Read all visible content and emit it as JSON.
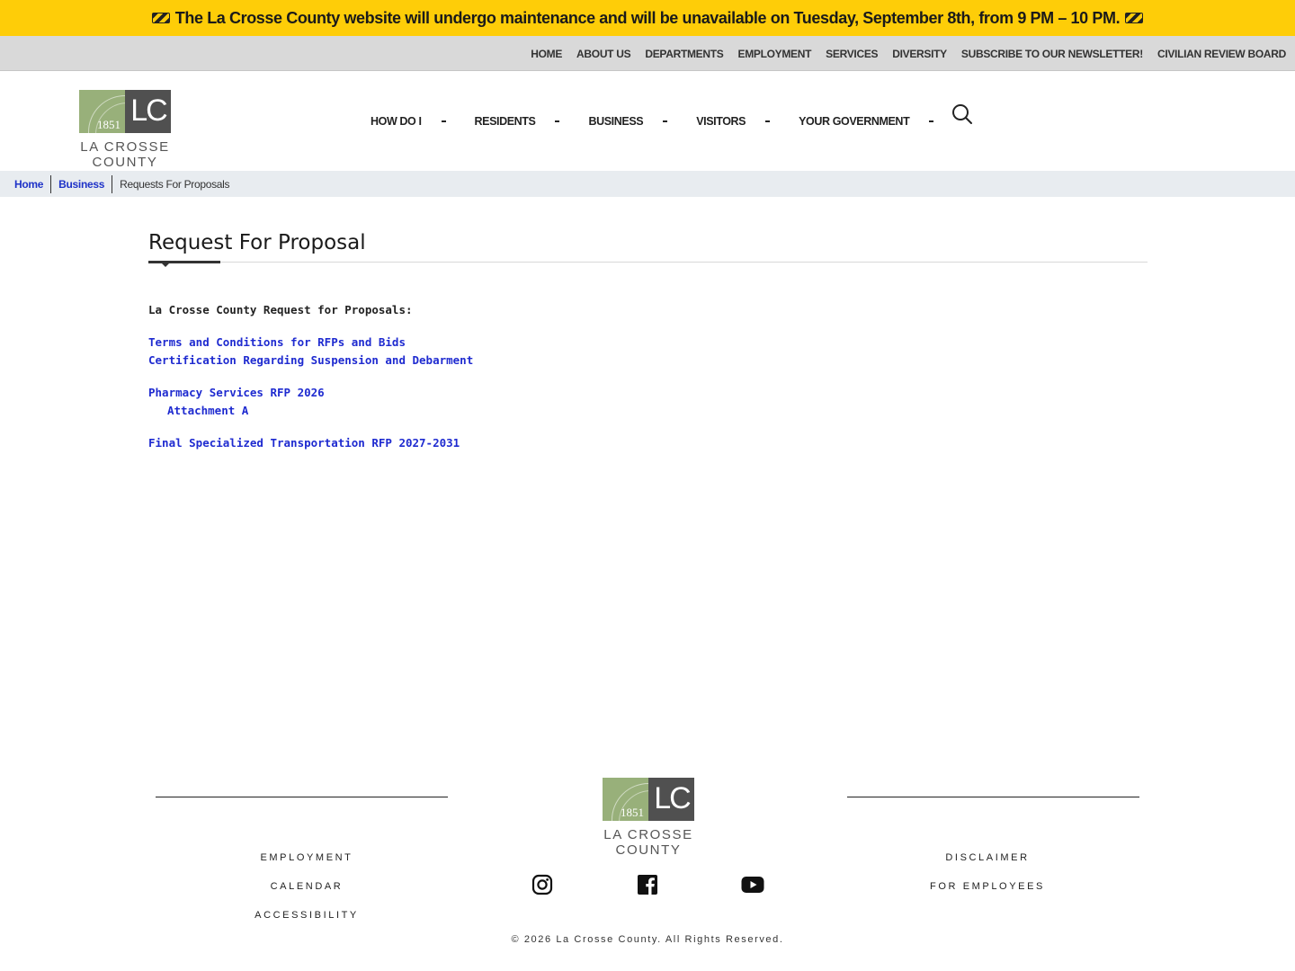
{
  "alert": {
    "text": "The La Crosse County website will undergo maintenance and will be unavailable on Tuesday, September 8th, from 9 PM – 10 PM."
  },
  "utility_nav": {
    "items": [
      {
        "label": "HOME"
      },
      {
        "label": "ABOUT US"
      },
      {
        "label": "DEPARTMENTS"
      },
      {
        "label": "EMPLOYMENT"
      },
      {
        "label": "SERVICES"
      },
      {
        "label": "DIVERSITY"
      },
      {
        "label": "SUBSCRIBE TO OUR NEWSLETTER!"
      },
      {
        "label": "CIVILIAN REVIEW BOARD"
      }
    ]
  },
  "logo": {
    "year": "1851",
    "initials": "LC",
    "name": "LA CROSSE COUNTY"
  },
  "primary_nav": {
    "items": [
      {
        "label": "HOW DO I"
      },
      {
        "label": "RESIDENTS"
      },
      {
        "label": "BUSINESS"
      },
      {
        "label": "VISITORS"
      },
      {
        "label": "YOUR GOVERNMENT"
      }
    ]
  },
  "breadcrumb": {
    "home": "Home",
    "business": "Business",
    "current": "Requests For Proposals"
  },
  "page": {
    "title": "Request For Proposal",
    "intro": "La Crosse County Request for Proposals:",
    "links": {
      "terms": "Terms and Conditions for RFPs and Bids",
      "certification": "Certification Regarding Suspension and Debarment",
      "pharmacy": "Pharmacy Services RFP 2026",
      "attachment": "Attachment A",
      "transportation": "Final Specialized Transportation RFP 2027-2031"
    }
  },
  "footer": {
    "left_links": [
      {
        "label": "EMPLOYMENT"
      },
      {
        "label": "CALENDAR"
      },
      {
        "label": "ACCESSIBILITY"
      }
    ],
    "right_links": [
      {
        "label": "DISCLAIMER"
      },
      {
        "label": "FOR EMPLOYEES"
      }
    ],
    "social": [
      "instagram-icon",
      "facebook-icon",
      "youtube-icon"
    ],
    "copyright": "© 2026 La Crosse County. All Rights Reserved."
  },
  "colors": {
    "alert_bg": "#fecd08",
    "link_blue": "#1f2bd0",
    "logo_green": "#98b07a",
    "logo_dark": "#505050"
  }
}
